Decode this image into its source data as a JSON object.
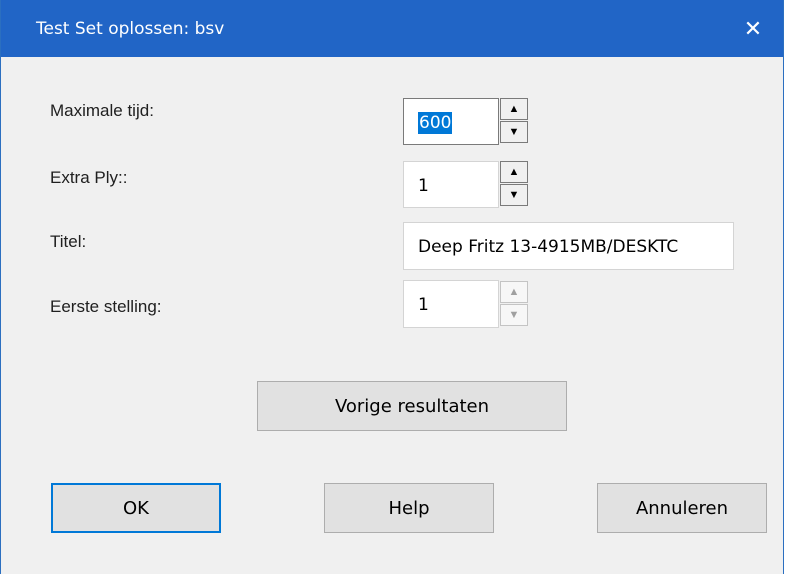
{
  "dialog": {
    "title": "Test Set oplossen: bsv",
    "close_glyph": "✕"
  },
  "fields": {
    "max_time_label": "Maximale tijd:",
    "max_time_value": "600",
    "extra_ply_label": "Extra Ply::",
    "extra_ply_value": "1",
    "title_label": "Titel:",
    "title_value": "Deep Fritz 13-4915MB/DESKTC",
    "first_position_label": "Eerste stelling:",
    "first_position_value": "1"
  },
  "spin": {
    "up": "▲",
    "down": "▼"
  },
  "buttons": {
    "previous_results": "Vorige resultaten",
    "ok": "OK",
    "help": "Help",
    "cancel": "Annuleren"
  },
  "colors": {
    "titlebar": "#2165c6",
    "selection": "#0078d7",
    "dialog_bg": "#f0f0f0"
  }
}
